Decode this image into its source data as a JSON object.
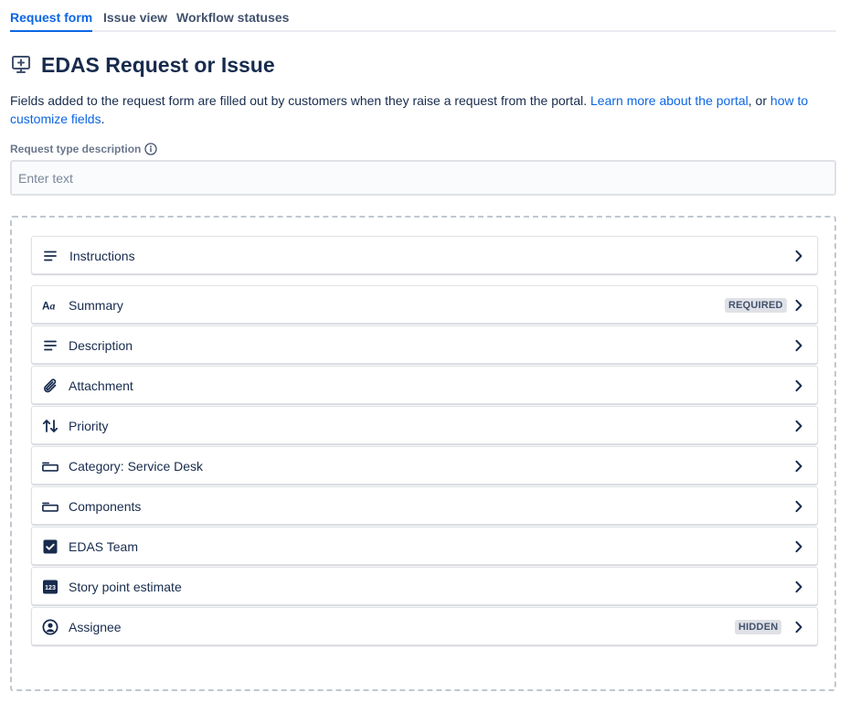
{
  "tabs": [
    {
      "label": "Request form",
      "active": true
    },
    {
      "label": "Issue view",
      "active": false
    },
    {
      "label": "Workflow statuses",
      "active": false
    }
  ],
  "header": {
    "icon": "monitor-plus-icon",
    "title": "EDAS Request or Issue"
  },
  "intro": {
    "text_before": "Fields added to the request form are filled out by customers when they raise a request from the portal. ",
    "link1": "Learn more about the portal",
    "text_middle": ", or ",
    "link2": "how to customize fields",
    "text_after": "."
  },
  "description_field": {
    "label": "Request type description",
    "placeholder": "Enter text",
    "value": ""
  },
  "colors": {
    "accent": "#0c66e4",
    "text": "#172b4d",
    "subtle": "#6b778c",
    "border": "#dfe1e6"
  },
  "fields": [
    {
      "label": "Instructions",
      "icon": "text-lines-icon",
      "badge": ""
    },
    {
      "label": "Summary",
      "icon": "text-field-icon",
      "badge": "REQUIRED"
    },
    {
      "label": "Description",
      "icon": "text-lines-icon",
      "badge": ""
    },
    {
      "label": "Attachment",
      "icon": "paperclip-icon",
      "badge": ""
    },
    {
      "label": "Priority",
      "icon": "priority-arrows-icon",
      "badge": ""
    },
    {
      "label": "Category: Service Desk",
      "icon": "select-box-icon",
      "badge": ""
    },
    {
      "label": "Components",
      "icon": "select-box-icon",
      "badge": ""
    },
    {
      "label": "EDAS Team",
      "icon": "checkbox-icon",
      "badge": ""
    },
    {
      "label": "Story point estimate",
      "icon": "number-icon",
      "badge": ""
    },
    {
      "label": "Assignee",
      "icon": "user-avatar-icon",
      "badge": "HIDDEN"
    }
  ]
}
